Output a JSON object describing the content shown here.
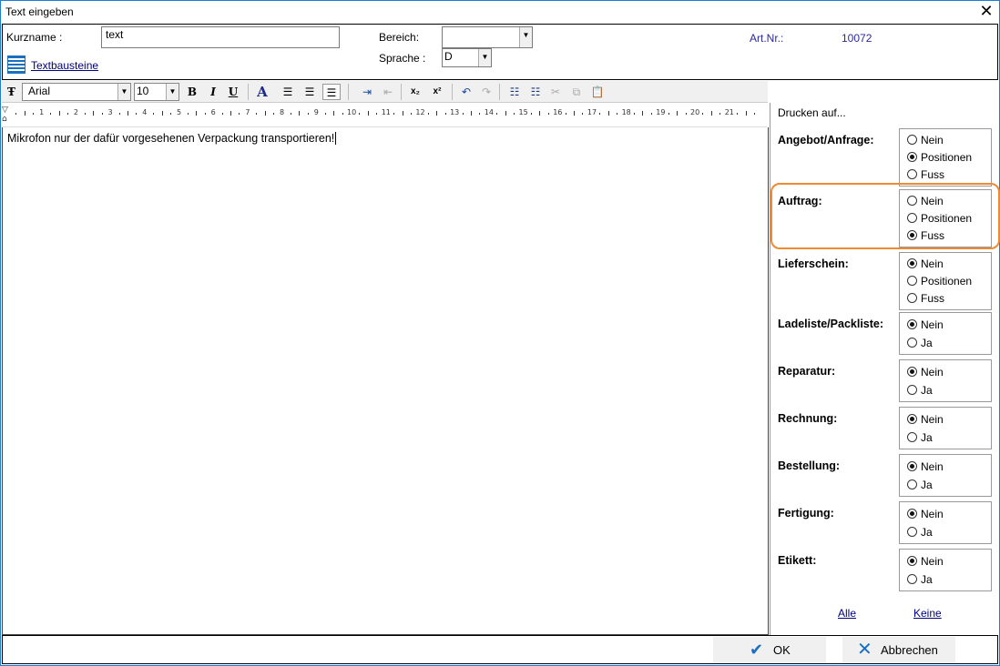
{
  "window": {
    "title": "Text eingeben",
    "close": "✕"
  },
  "header": {
    "kurzname_label": "Kurzname :",
    "kurzname_value": "text",
    "textbausteine": "Textbausteine",
    "bereich_label": "Bereich:",
    "bereich_value": "",
    "sprache_label": "Sprache :",
    "sprache_value": "D",
    "artnr_label": "Art.Nr.:",
    "artnr_value": "10072",
    "accent": "#2a2aa0"
  },
  "toolbar": {
    "font": "Arial",
    "size": "10",
    "bold": "B",
    "italic": "I",
    "underline": "U",
    "color": "A",
    "sub": "x₂",
    "sup": "x²"
  },
  "ruler": {
    "ticks": [
      "1",
      "2",
      "3",
      "4",
      "5",
      "6",
      "7",
      "8",
      "9",
      "10",
      "11",
      "12",
      "13",
      "14",
      "15",
      "16",
      "17",
      "18",
      "19",
      "20",
      "21"
    ]
  },
  "editor": {
    "text": "Mikrofon nur der dafür vorgesehenen Verpackung transportieren!"
  },
  "print": {
    "legend": "Drucken auf...",
    "groups": [
      {
        "label": "Angebot/Anfrage:",
        "options": [
          "Nein",
          "Positionen",
          "Fuss"
        ],
        "selected": 1
      },
      {
        "label": "Auftrag:",
        "options": [
          "Nein",
          "Positionen",
          "Fuss"
        ],
        "selected": 2
      },
      {
        "label": "Lieferschein:",
        "options": [
          "Nein",
          "Positionen",
          "Fuss"
        ],
        "selected": 0
      },
      {
        "label": "Ladeliste/Packliste:",
        "options": [
          "Nein",
          "Ja"
        ],
        "selected": 0
      },
      {
        "label": "Reparatur:",
        "options": [
          "Nein",
          "Ja"
        ],
        "selected": 0
      },
      {
        "label": "Rechnung:",
        "options": [
          "Nein",
          "Ja"
        ],
        "selected": 0
      },
      {
        "label": "Bestellung:",
        "options": [
          "Nein",
          "Ja"
        ],
        "selected": 0
      },
      {
        "label": "Fertigung:",
        "options": [
          "Nein",
          "Ja"
        ],
        "selected": 0
      },
      {
        "label": "Etikett:",
        "options": [
          "Nein",
          "Ja"
        ],
        "selected": 0
      }
    ],
    "all": "Alle",
    "none": "Keine",
    "highlight_color": "#f08a30"
  },
  "footer": {
    "ok": "OK",
    "cancel": "Abbrechen"
  }
}
